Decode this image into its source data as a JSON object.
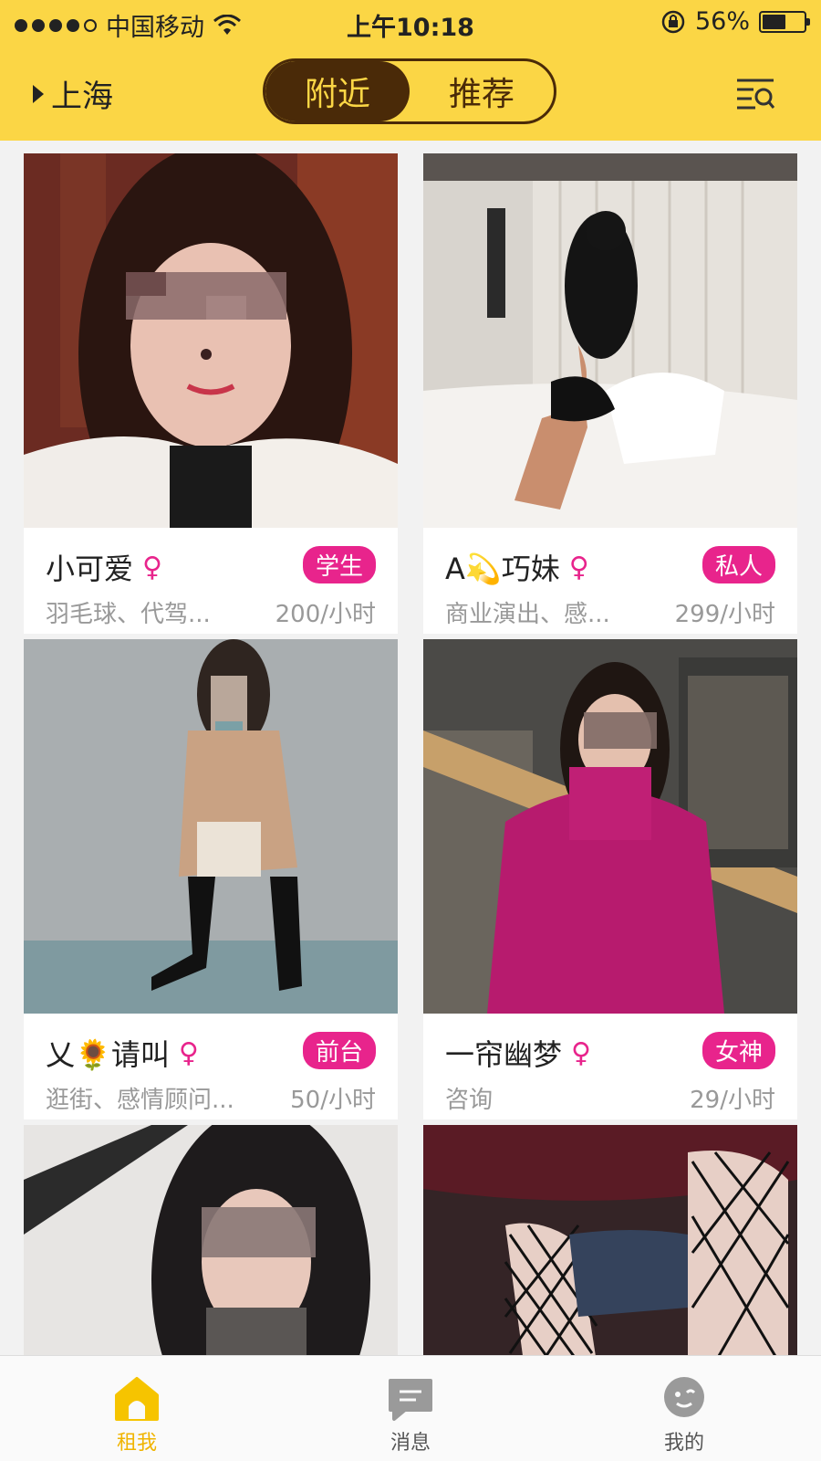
{
  "status": {
    "carrier": "中国移动",
    "time": "上午10:18",
    "battery": "56%",
    "battery_level": 0.56
  },
  "header": {
    "city": "上海",
    "tabs": [
      "附近",
      "推荐"
    ]
  },
  "cards": [
    {
      "name": "小可爱",
      "gender": "♀",
      "tag": "学生",
      "interests": "羽毛球、代驾...",
      "price": "200/小时"
    },
    {
      "name": "A💫巧妹",
      "gender": "♀",
      "tag": "私人",
      "interests": "商业演出、感...",
      "price": "299/小时"
    },
    {
      "name": "乂🌻请叫",
      "gender": "♀",
      "tag": "前台",
      "interests": "逛街、感情顾问...",
      "price": "50/小时"
    },
    {
      "name": "一帘幽梦",
      "gender": "♀",
      "tag": "女神",
      "interests": "咨询",
      "price": "29/小时"
    }
  ],
  "tabbar": {
    "items": [
      {
        "label": "租我",
        "icon": "home-icon"
      },
      {
        "label": "消息",
        "icon": "message-icon"
      },
      {
        "label": "我的",
        "icon": "profile-icon"
      }
    ]
  },
  "colors": {
    "brand_yellow": "#fbd645",
    "dark_brown": "#4a2a08",
    "pink": "#e8248c",
    "active_tab": "#f0b400"
  }
}
